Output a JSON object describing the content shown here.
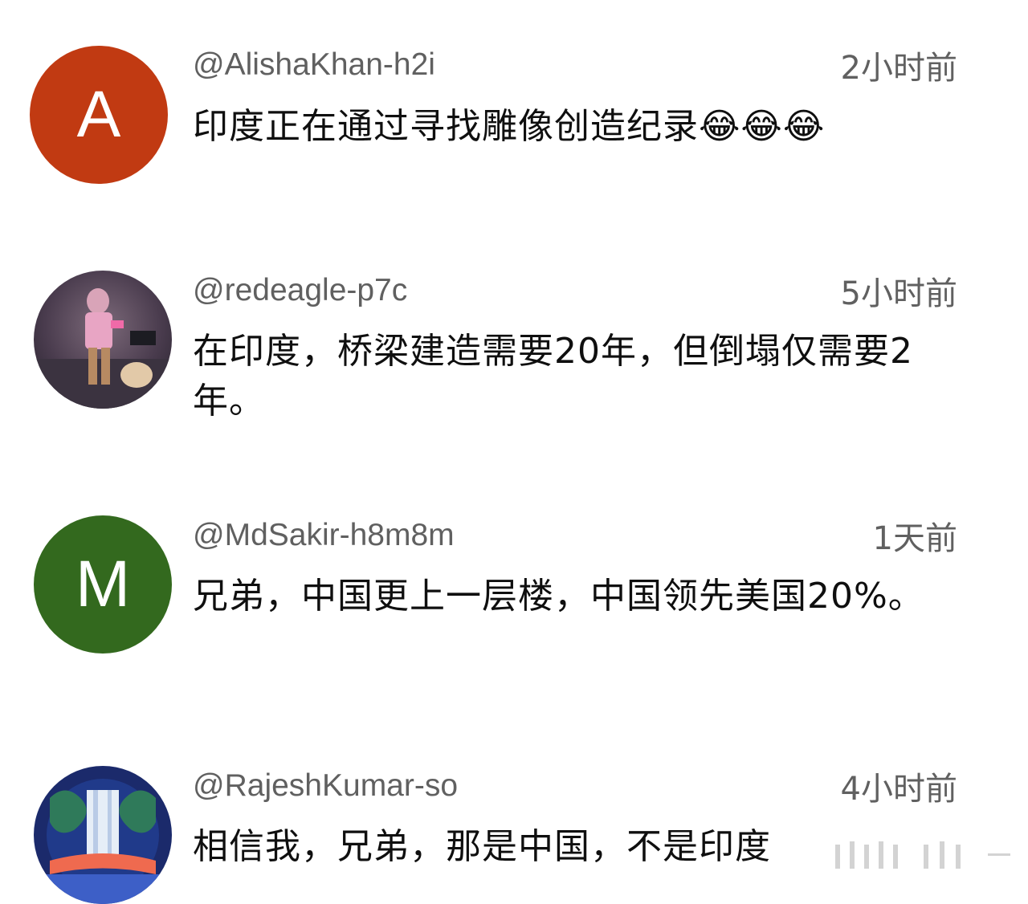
{
  "comments": [
    {
      "handle": "@AlishaKhan-h2i",
      "time": "2小时前",
      "text": "印度正在通过寻找雕像创造纪录😂😂😂",
      "avatar": {
        "type": "letter",
        "letter": "A",
        "color": "#c13a12"
      }
    },
    {
      "handle": "@redeagle-p7c",
      "time": "5小时前",
      "text": "在印度，桥梁建造需要20年，但倒塌仅需要2年。",
      "avatar": {
        "type": "image",
        "icon": "person-photo-icon"
      }
    },
    {
      "handle": "@MdSakir-h8m8m",
      "time": "1天前",
      "text": "兄弟，中国更上一层楼，中国领先美国20%。",
      "avatar": {
        "type": "letter",
        "letter": "M",
        "color": "#33691e"
      }
    },
    {
      "handle": "@RajeshKumar-so",
      "time": "4小时前",
      "text": "相信我，兄弟，那是中国，不是印度",
      "avatar": {
        "type": "image",
        "icon": "waterfall-art-icon"
      }
    }
  ],
  "colors": {
    "handle": "#606060",
    "text": "#0f0f0f",
    "background": "#ffffff"
  }
}
